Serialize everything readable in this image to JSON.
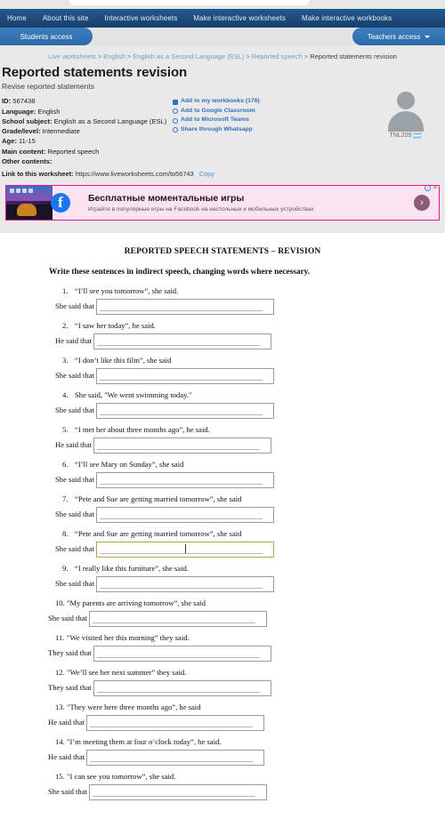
{
  "topnav": {
    "items": [
      {
        "label": "Home"
      },
      {
        "label": "About this site"
      },
      {
        "label": "Interactive worksheets"
      },
      {
        "label": "Make interactive worksheets"
      },
      {
        "label": "Make interactive workbooks"
      }
    ]
  },
  "subnav": {
    "students_access": "Students access",
    "teachers_access": "Teachers access"
  },
  "breadcrumb": {
    "items": [
      "Live worksheets",
      "English",
      "English as a Second Language (ESL)",
      "Reported speech",
      "Reported statements revision"
    ],
    "separator": ">"
  },
  "worksheet_header": {
    "title": "Reported statements revision",
    "subtitle": "Revise reported statements",
    "meta": [
      {
        "label": "ID:",
        "value": "567438"
      },
      {
        "label": "Language:",
        "value": "English"
      },
      {
        "label": "School subject:",
        "value": "English as a Second Language (ESL)"
      },
      {
        "label": "Grade/level:",
        "value": "Intermediate"
      },
      {
        "label": "Age:",
        "value": "11-15"
      },
      {
        "label": "Main content:",
        "value": "Reported speech"
      },
      {
        "label": "Other contents:",
        "value": ""
      }
    ],
    "share_links": [
      {
        "label": "Add to my workbooks (176)",
        "icon": "workbook-icon"
      },
      {
        "label": "Add to Google Classroom",
        "icon": "google-classroom-icon"
      },
      {
        "label": "Add to Microsoft Teams",
        "icon": "microsoft-teams-icon"
      },
      {
        "label": "Share through Whatsapp",
        "icon": "whatsapp-icon"
      }
    ],
    "author": {
      "name": "TNL209",
      "flag": "argentina-flag-icon"
    },
    "link_row": {
      "label": "Link to this worksheet:",
      "url": "https://www.liveworksheets.com/to56743",
      "copy": "Copy"
    }
  },
  "ad": {
    "title": "Бесплатные моментальные игры",
    "description": "Играйте в популярные игры на Facebook на настольных и мобильных устройствах",
    "brand_glyph": "f",
    "arrow_glyph": "›",
    "adchoices_glyph": "i",
    "close_glyph": "✕",
    "border_color": "#e8138e"
  },
  "sheet": {
    "title": "REPORTED SPEECH STATEMENTS – REVISION",
    "instructions": "Write these sentences in indirect speech, changing words where necessary.",
    "focus_color": "#bfa04a",
    "questions": [
      {
        "num": "1.",
        "prompt": "“I’ll see you tomorrow”, she said.",
        "lead": "She said that",
        "value": "",
        "focused": false
      },
      {
        "num": "2.",
        "prompt": "“I saw her today”, he said.",
        "lead": "He said that",
        "value": "",
        "focused": false
      },
      {
        "num": "3.",
        "prompt": "“I don’t like this film”, she said",
        "lead": "She said that",
        "value": "",
        "focused": false
      },
      {
        "num": "4.",
        "prompt": "She said, \"We went swimming today.\"",
        "lead": "She said that",
        "value": "",
        "focused": false
      },
      {
        "num": "5.",
        "prompt": "“I met her about three months ago”, he said.",
        "lead": "He said that",
        "value": "",
        "focused": false
      },
      {
        "num": "6.",
        "prompt": "“I’ll see Mary on Sunday”, she said",
        "lead": "She said that",
        "value": "",
        "focused": false
      },
      {
        "num": "7.",
        "prompt": "“Pete and Sue are getting married tomorrow”, she said",
        "lead": "She said that",
        "value": "",
        "focused": false
      },
      {
        "num": "8.",
        "prompt": "“Pete and Sue are getting married tomorrow”, she said",
        "lead": "She said that",
        "value": "",
        "focused": true
      },
      {
        "num": "9.",
        "prompt": "“I really like this furniture”, she said.",
        "lead": "She said that",
        "value": "",
        "focused": false
      },
      {
        "num": "10.",
        "prompt": "\"My parents are arriving tomorrow”, she said",
        "lead": "She said that",
        "value": "",
        "focused": false
      },
      {
        "num": "11.",
        "prompt": "\"We visited her this morning” they said.",
        "lead": "They said that",
        "value": "",
        "focused": false
      },
      {
        "num": "12.",
        "prompt": "\"We’ll see her next summer” they said.",
        "lead": "They said that",
        "value": "",
        "focused": false
      },
      {
        "num": "13.",
        "prompt": "\"They were here three months ago”, he said",
        "lead": "He said that",
        "value": "",
        "focused": false
      },
      {
        "num": "14.",
        "prompt": "\"I’m meeting them at four o’clock today”, he said.",
        "lead": "He said that",
        "value": "",
        "focused": false
      },
      {
        "num": "15.",
        "prompt": "\"I can see you tomorrow”, she said.",
        "lead": "She said that",
        "value": "",
        "focused": false
      }
    ]
  }
}
